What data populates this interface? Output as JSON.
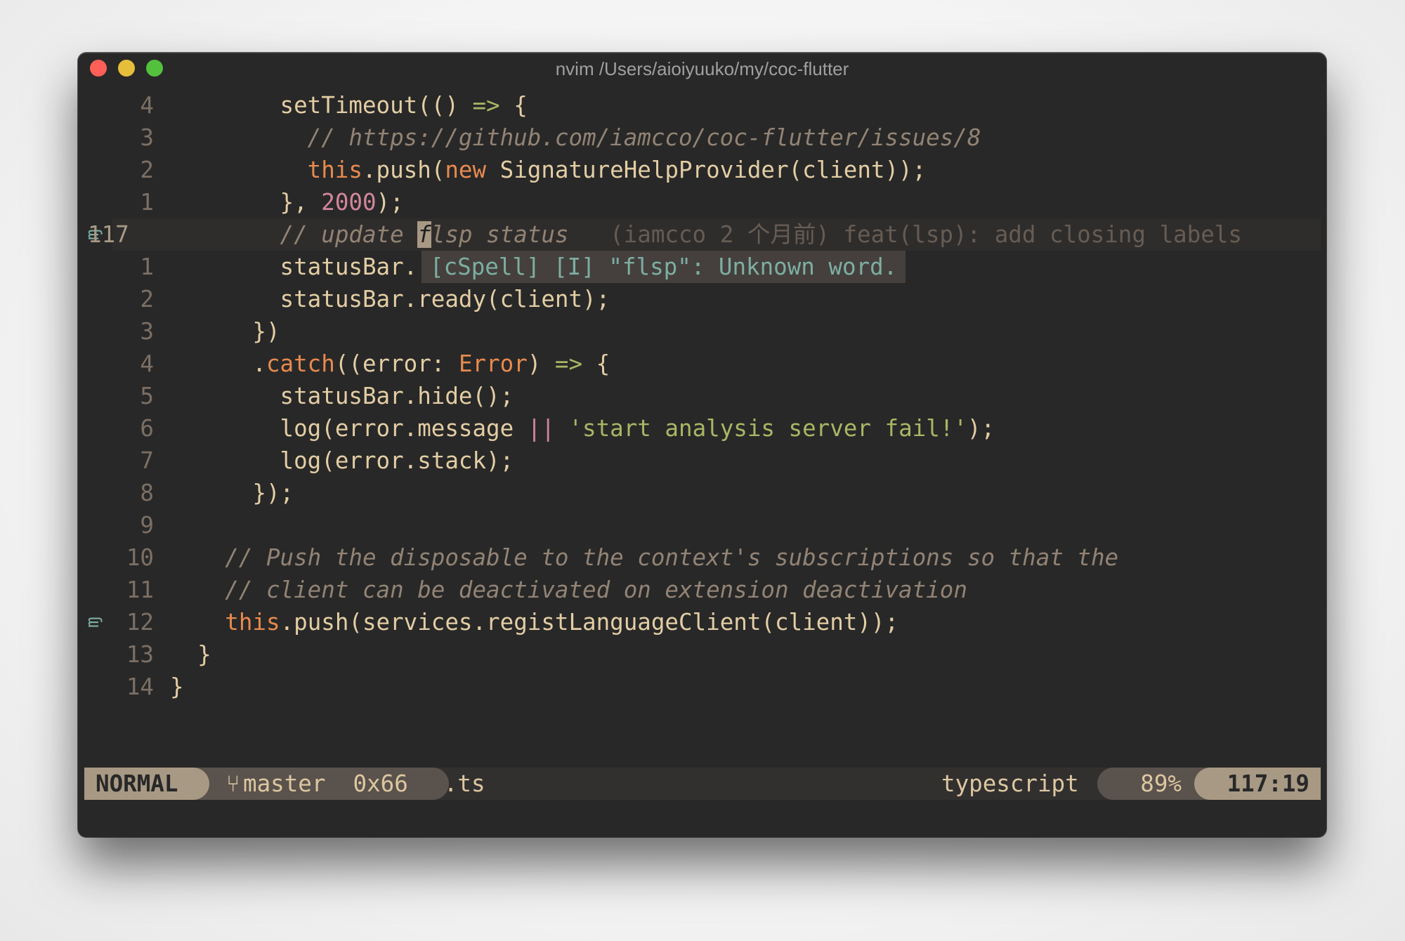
{
  "window": {
    "title": "nvim /Users/aioiyuuko/my/coc-flutter",
    "buttons": [
      "close",
      "minimize",
      "maximize"
    ]
  },
  "editor": {
    "lines": [
      {
        "lnr": "4",
        "indent": "        ",
        "tokens": [
          {
            "t": "setTimeout(() ",
            "c": ""
          },
          {
            "t": "=>",
            "c": "op"
          },
          {
            "t": " {",
            "c": ""
          }
        ]
      },
      {
        "lnr": "3",
        "indent": "          ",
        "tokens": [
          {
            "t": "// https://github.com/iamcco/coc-flutter/issues/8",
            "c": "comment"
          }
        ]
      },
      {
        "lnr": "2",
        "indent": "          ",
        "tokens": [
          {
            "t": "this",
            "c": "kw"
          },
          {
            "t": ".push(",
            "c": ""
          },
          {
            "t": "new",
            "c": "kw"
          },
          {
            "t": " SignatureHelpProvider(client));",
            "c": ""
          }
        ]
      },
      {
        "lnr": "1",
        "indent": "        ",
        "tokens": [
          {
            "t": "}, ",
            "c": ""
          },
          {
            "t": "2000",
            "c": "num"
          },
          {
            "t": ");",
            "c": ""
          }
        ]
      },
      {
        "lnr": "117",
        "indent": "        ",
        "cursorline": true,
        "sign": "spell-sign-icon",
        "tokens": [
          {
            "t": "// update ",
            "c": "comment"
          },
          {
            "t": "f",
            "c": "cursor"
          },
          {
            "t": "lsp status",
            "c": "comment"
          }
        ],
        "blame": "(iamcco 2 个月前) feat(lsp): add closing labels"
      },
      {
        "lnr": "1",
        "indent": "        ",
        "tokens": [
          {
            "t": "statusBar.",
            "c": ""
          }
        ],
        "float": "[cSpell] [I] \"flsp\": Unknown word."
      },
      {
        "lnr": "2",
        "indent": "        ",
        "tokens": [
          {
            "t": "statusBar.ready(client);",
            "c": ""
          }
        ]
      },
      {
        "lnr": "3",
        "indent": "      ",
        "tokens": [
          {
            "t": "})",
            "c": ""
          }
        ]
      },
      {
        "lnr": "4",
        "indent": "      ",
        "tokens": [
          {
            "t": ".",
            "c": ""
          },
          {
            "t": "catch",
            "c": "kw"
          },
          {
            "t": "((error: ",
            "c": ""
          },
          {
            "t": "Error",
            "c": "kw"
          },
          {
            "t": ") ",
            "c": ""
          },
          {
            "t": "=>",
            "c": "op"
          },
          {
            "t": " {",
            "c": ""
          }
        ]
      },
      {
        "lnr": "5",
        "indent": "        ",
        "tokens": [
          {
            "t": "statusBar.hide();",
            "c": ""
          }
        ]
      },
      {
        "lnr": "6",
        "indent": "        ",
        "tokens": [
          {
            "t": "log(error.message ",
            "c": ""
          },
          {
            "t": "||",
            "c": "pipe"
          },
          {
            "t": " ",
            "c": ""
          },
          {
            "t": "'start analysis server fail!'",
            "c": "str"
          },
          {
            "t": ");",
            "c": ""
          }
        ]
      },
      {
        "lnr": "7",
        "indent": "        ",
        "tokens": [
          {
            "t": "log(error.stack);",
            "c": ""
          }
        ]
      },
      {
        "lnr": "8",
        "indent": "      ",
        "tokens": [
          {
            "t": "});",
            "c": ""
          }
        ]
      },
      {
        "lnr": "9",
        "indent": "",
        "tokens": []
      },
      {
        "lnr": "10",
        "indent": "    ",
        "tokens": [
          {
            "t": "// Push the disposable to the context's subscriptions so that the",
            "c": "comment"
          }
        ]
      },
      {
        "lnr": "11",
        "indent": "    ",
        "tokens": [
          {
            "t": "// client can be deactivated on extension deactivation",
            "c": "comment"
          }
        ]
      },
      {
        "lnr": "12",
        "indent": "    ",
        "sign": "spell-sign-icon",
        "tokens": [
          {
            "t": "this",
            "c": "kw"
          },
          {
            "t": ".push(services.registLanguageClient(client));",
            "c": ""
          }
        ]
      },
      {
        "lnr": "13",
        "indent": "  ",
        "tokens": [
          {
            "t": "}",
            "c": ""
          }
        ]
      },
      {
        "lnr": "14",
        "indent": "",
        "tokens": [
          {
            "t": "}",
            "c": ""
          }
        ]
      }
    ]
  },
  "statusline": {
    "mode": "NORMAL",
    "branch_icon": "git-branch-icon",
    "branch": "master",
    "char_code": "0x66",
    "filename": "index.ts",
    "filetype": "typescript",
    "percent": "89%",
    "position": "117:19"
  },
  "colors": {
    "background": "#282828",
    "foreground": "#e3cda4",
    "keyword": "#e78a4e",
    "string": "#a9b665",
    "number": "#d3869b",
    "comment": "#928374",
    "float_text": "#7daea3",
    "mode_bg": "#a89984"
  }
}
